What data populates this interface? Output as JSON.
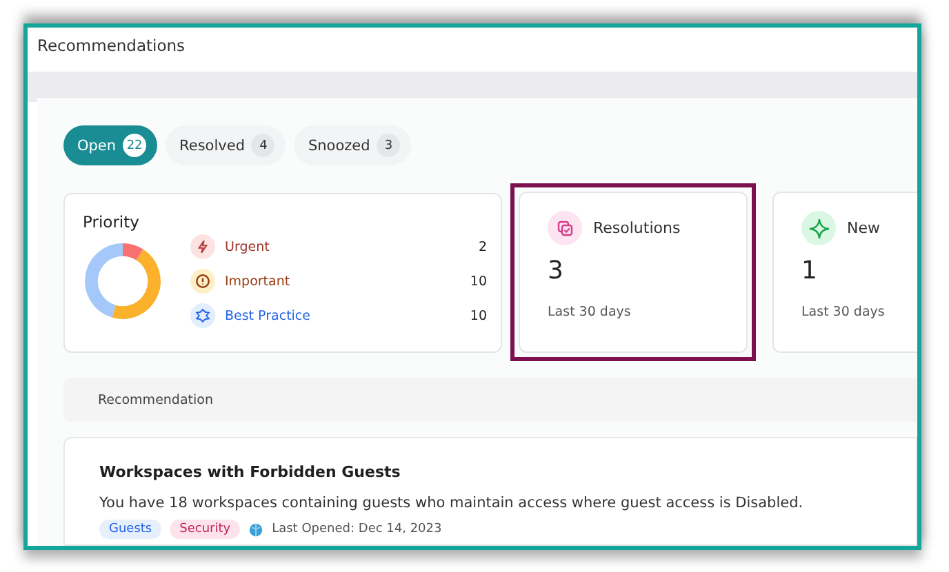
{
  "window": {
    "title": "Recommendations"
  },
  "tabs": [
    {
      "label": "Open",
      "count": "22",
      "selected": true
    },
    {
      "label": "Resolved",
      "count": "4",
      "selected": false
    },
    {
      "label": "Snoozed",
      "count": "3",
      "selected": false
    }
  ],
  "priority": {
    "title": "Priority",
    "items": [
      {
        "kind": "urgent",
        "label": "Urgent",
        "count": "2",
        "color": "#f87171"
      },
      {
        "kind": "important",
        "label": "Important",
        "count": "10",
        "color": "#fbb12b"
      },
      {
        "kind": "best_practice",
        "label": "Best Practice",
        "count": "10",
        "color": "#a5c8fb"
      }
    ]
  },
  "stat_cards": [
    {
      "kind": "resolutions",
      "title": "Resolutions",
      "value": "3",
      "period": "Last 30 days",
      "highlighted": true
    },
    {
      "kind": "new",
      "title": "New",
      "value": "1",
      "period": "Last 30 days",
      "highlighted": false
    }
  ],
  "table": {
    "columns": [
      "Recommendation"
    ]
  },
  "recommendations": [
    {
      "title": "Workspaces with Forbidden Guests",
      "description": "You have 18 workspaces containing guests who maintain access where guest access is Disabled.",
      "tags": [
        {
          "kind": "guests",
          "label": "Guests"
        },
        {
          "kind": "security",
          "label": "Security"
        }
      ],
      "last_opened": "Last Opened: Dec 14, 2023"
    }
  ]
}
